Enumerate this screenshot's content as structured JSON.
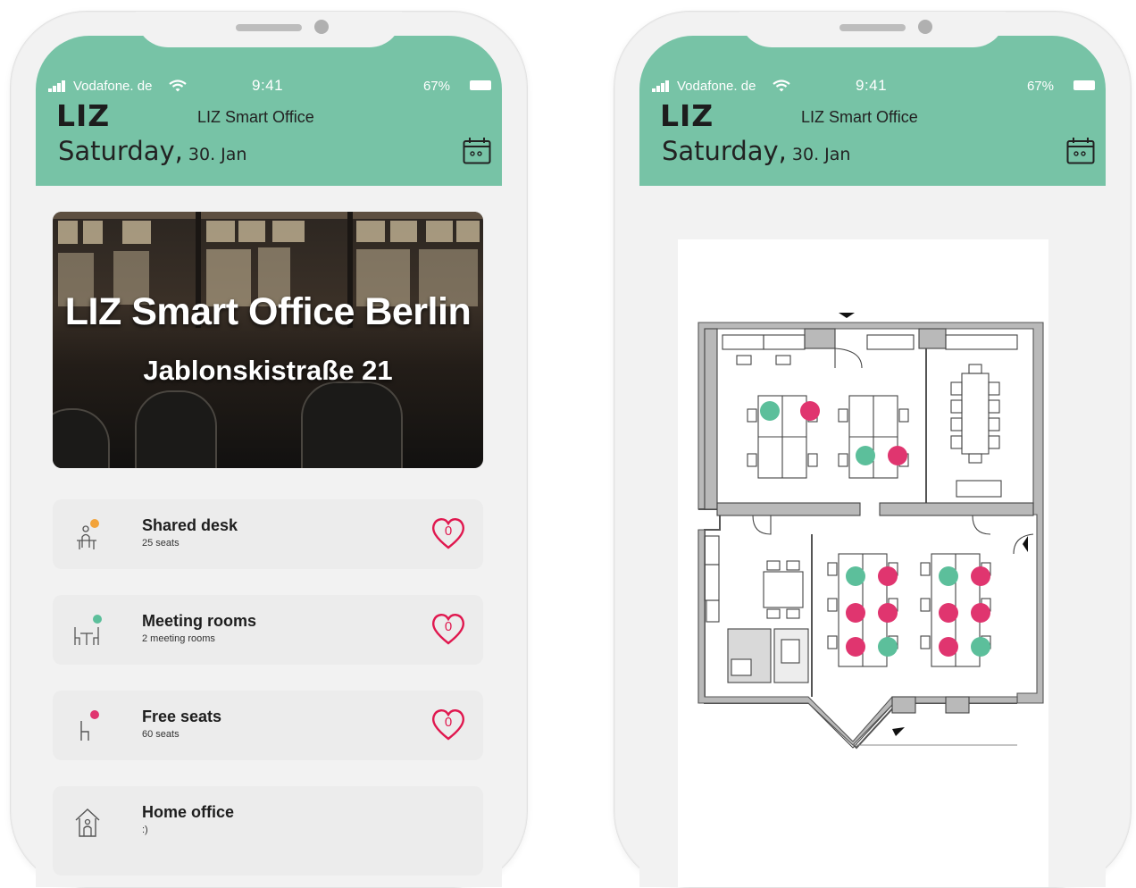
{
  "status": {
    "carrier": "Vodafone. de",
    "time": "9:41",
    "battery": "67%"
  },
  "header": {
    "brand": "LIZ",
    "app_title": "LIZ Smart Office",
    "day": "Saturday,",
    "date": "30. Jan"
  },
  "hero": {
    "title": "LIZ Smart Office Berlin",
    "address": "Jablonskistraße 21"
  },
  "cards": [
    {
      "label": "Shared desk",
      "sub": "25 seats",
      "count": "0",
      "icon": "shared-desk-icon",
      "dot_color": "#f2a33a"
    },
    {
      "label": "Meeting rooms",
      "sub": "2 meeting rooms",
      "count": "0",
      "icon": "meeting-room-icon",
      "dot_color": "#5cbf9b"
    },
    {
      "label": "Free seats",
      "sub": "60 seats",
      "count": "0",
      "icon": "chair-icon",
      "dot_color": "#e0356f"
    },
    {
      "label": "Home office",
      "sub": ":)",
      "icon": "home-icon"
    }
  ],
  "colors": {
    "header": "#77c3a6",
    "occupied": "#e0356f",
    "free": "#5cbf9b",
    "heart": "#e0184f"
  }
}
